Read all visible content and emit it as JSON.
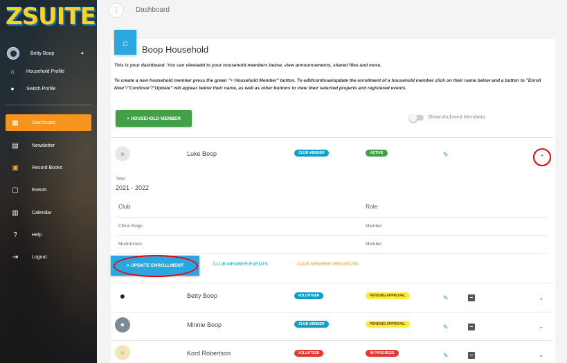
{
  "sidebar": {
    "logo": "ZSUITE",
    "user_name": "Betty Boop",
    "profile_links": [
      {
        "icon": "home-icon",
        "label": "Household Profile"
      },
      {
        "icon": "person-icon",
        "label": "Switch Profile"
      }
    ],
    "nav": [
      {
        "icon": "dashboard-icon",
        "label": "Dashboard"
      },
      {
        "icon": "newsletter-icon",
        "label": "Newsletter"
      },
      {
        "icon": "record-books-icon",
        "label": "Record Books"
      },
      {
        "icon": "events-icon",
        "label": "Events"
      },
      {
        "icon": "calendar-icon",
        "label": "Calendar"
      },
      {
        "icon": "help-icon",
        "label": "Help"
      },
      {
        "icon": "logout-icon",
        "label": "Logout"
      }
    ],
    "active_item": "Dashboard",
    "accent_color": "#f7941d"
  },
  "header": {
    "breadcrumb": "Dashboard"
  },
  "household": {
    "title": "Boop Household",
    "intro1": "This is your dashboard. You can view/add to your household members below, view announcements, shared files and more.",
    "intro2": "To create a new household member press the green \"+ Household Member\" button. To edit/continue/update the enrollment of a household member click on their name below and a button to \"Enroll Now\"/\"Continue\"/\"Update\" will appear below their name, as well as other buttons to view their selected projects and registered events.",
    "add_button": "+ HOUSEHOLD MEMBER",
    "archived_toggle_label": "Show Archived Members"
  },
  "members": [
    {
      "name": "Luke Boop",
      "role_badge": "CLUB MEMBER",
      "status_badge": "ACTIVE",
      "expanded": true
    },
    {
      "name": "Betty Boop",
      "role_badge": "VOLUNTEER",
      "status_badge": "PENDING APPROVAL",
      "expanded": false
    },
    {
      "name": "Minnie Boop",
      "role_badge": "CLUB MEMBER",
      "status_badge": "PENDING APPROVAL",
      "expanded": false
    },
    {
      "name": "Kord Robertson",
      "role_badge": "VOLUNTEER",
      "status_badge": "IN PROGRESS",
      "expanded": false
    }
  ],
  "expanded_detail": {
    "year_label": "Year",
    "year_value": "2021 - 2022",
    "club_header": "Club",
    "role_header": "Role",
    "rows": [
      {
        "club": "Citrus Kings",
        "role": "Member"
      },
      {
        "club": "Mudrunners",
        "role": "Member"
      }
    ],
    "update_button": "> UPDATE ENROLLMENT",
    "events_link": "CLUB MEMBER EVENTS",
    "projects_link": "CLUB MEMBER PROJECTS"
  },
  "colors": {
    "blue": "#2aa7e1",
    "green": "#43a047",
    "yellow": "#ffeb3b",
    "red": "#e53935",
    "teal_badge": "#0aa0c8",
    "highlight": "#ee0000"
  }
}
